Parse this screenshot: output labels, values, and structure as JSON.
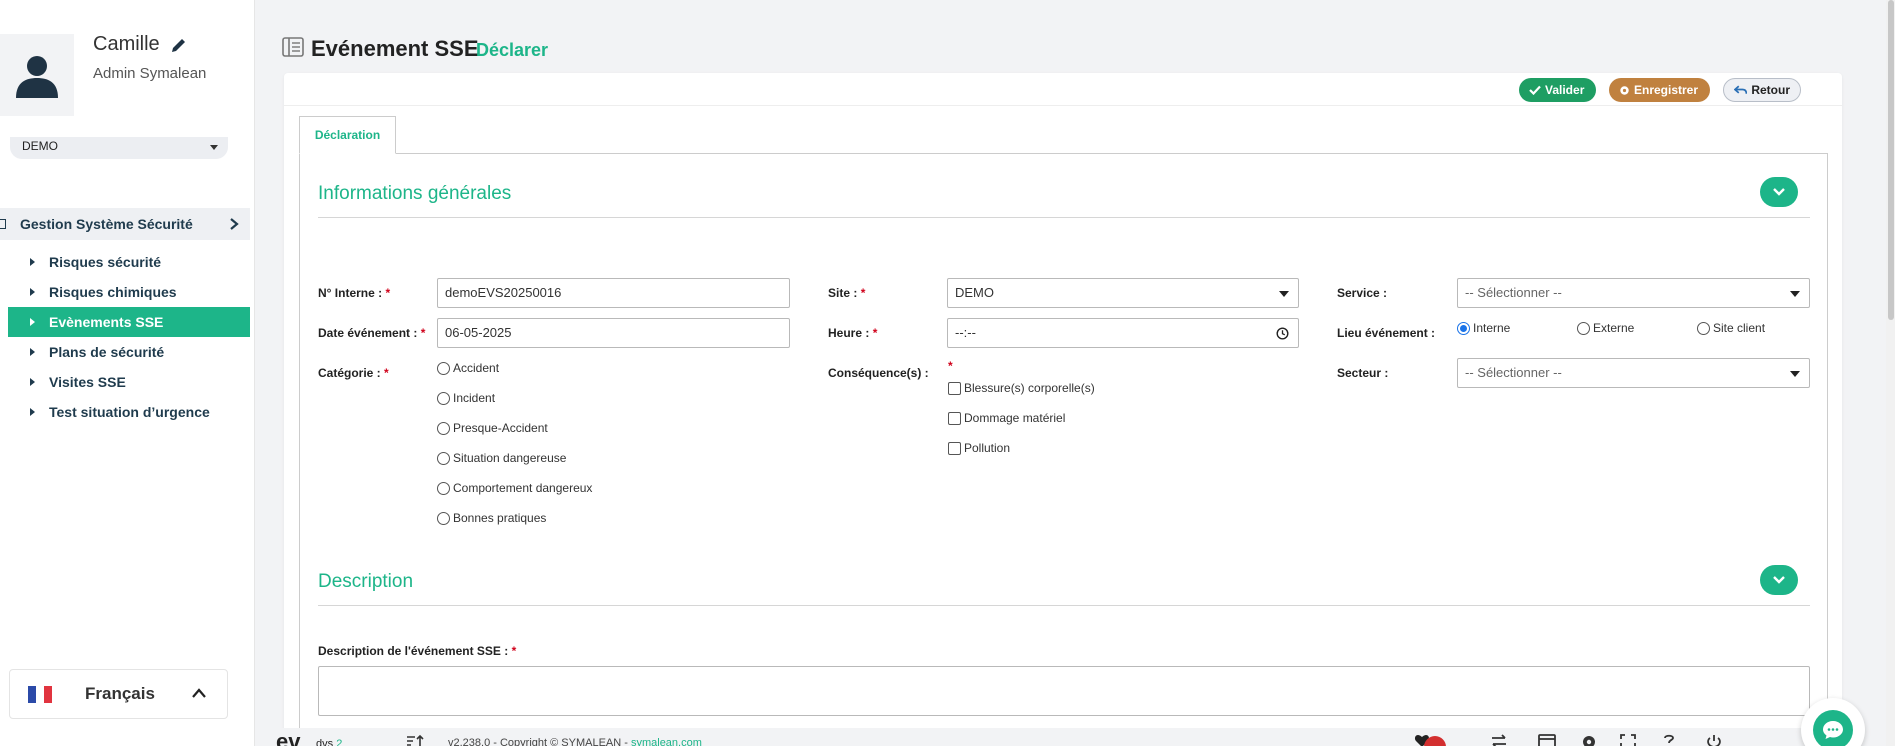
{
  "user": {
    "name": "Camille",
    "role": "Admin Symalean"
  },
  "org": {
    "selected": "DEMO"
  },
  "sidebar": {
    "group": "Gestion Système Sécurité",
    "items": [
      {
        "label": "Risques sécurité"
      },
      {
        "label": "Risques chimiques"
      },
      {
        "label": "Evènements SSE"
      },
      {
        "label": "Plans de sécurité"
      },
      {
        "label": "Visites SSE"
      },
      {
        "label": "Test situation d’urgence"
      }
    ]
  },
  "language": {
    "label": "Français"
  },
  "page": {
    "title": "Evénement SSE",
    "subtitle": "Déclarer"
  },
  "toolbar": {
    "valider": "Valider",
    "enregistrer": "Enregistrer",
    "retour": "Retour"
  },
  "tabs": {
    "declaration": "Déclaration"
  },
  "sections": {
    "general": "Informations générales",
    "description": "Description"
  },
  "form": {
    "num_interne": {
      "label": "N° Interne :",
      "value": "demoEVS20250016"
    },
    "site": {
      "label": "Site :",
      "value": "DEMO"
    },
    "service": {
      "label": "Service :",
      "placeholder": "-- Sélectionner --"
    },
    "date": {
      "label": "Date événement :",
      "value": "06-05-2025"
    },
    "heure": {
      "label": "Heure :",
      "value": "--:--"
    },
    "lieu": {
      "label": "Lieu événement :",
      "options": [
        "Interne",
        "Externe",
        "Site client"
      ],
      "selected": "Interne"
    },
    "categorie": {
      "label": "Catégorie :",
      "options": [
        "Accident",
        "Incident",
        "Presque-Accident",
        "Situation dangereuse",
        "Comportement dangereux",
        "Bonnes pratiques"
      ]
    },
    "consequences": {
      "label": "Conséquence(s) :",
      "options": [
        "Blessure(s) corporelle(s)",
        "Dommage matériel",
        "Pollution"
      ]
    },
    "secteur": {
      "label": "Secteur :",
      "placeholder": "-- Sélectionner --"
    },
    "description": {
      "label": "Description de l'événement SSE :"
    }
  },
  "required_mark": "*",
  "footer": {
    "brand": "ev",
    "brand_sub": "dvs",
    "brand_num": "2",
    "text": "v2.238.0 - Copyright © SYMALEAN - ",
    "link": "symalean.com"
  },
  "colors": {
    "accent": "#1db589",
    "valider": "#1e9e63",
    "enregistrer": "#c0813f",
    "required": "#d0021b"
  }
}
